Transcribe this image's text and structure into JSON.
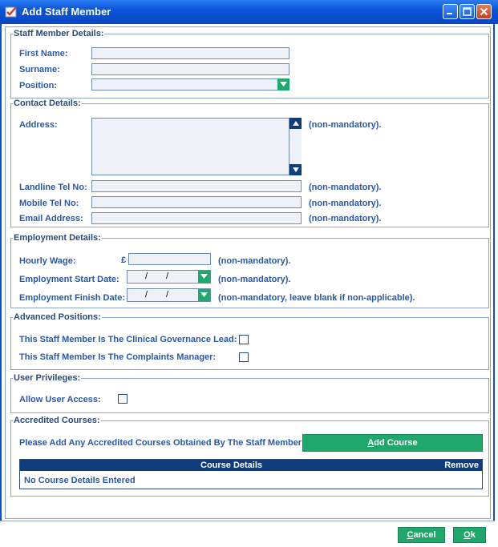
{
  "window": {
    "title": "Add Staff Member"
  },
  "staff_details": {
    "legend": "Staff Member Details:",
    "first_name_label": "First Name:",
    "first_name_value": "",
    "surname_label": "Surname:",
    "surname_value": "",
    "position_label": "Position:",
    "position_value": ""
  },
  "contact_details": {
    "legend": "Contact Details:",
    "address_label": "Address:",
    "address_note": "(non-mandatory).",
    "landline_label": "Landline Tel No:",
    "landline_note": "(non-mandatory).",
    "mobile_label": "Mobile Tel No:",
    "mobile_note": "(non-mandatory).",
    "email_label": "Email Address:",
    "email_note": "(non-mandatory)."
  },
  "employment": {
    "legend": "Employment Details:",
    "wage_label": "Hourly Wage:",
    "currency_symbol": "£",
    "wage_note": "(non-mandatory).",
    "start_label": "Employment Start Date:",
    "start_note": "(non-mandatory).",
    "finish_label": "Employment Finish Date:",
    "finish_note": "(non-mandatory, leave blank if non-applicable).",
    "date_separator": "/"
  },
  "advanced": {
    "legend": "Advanced Positions:",
    "clinical_label": "This Staff Member Is The Clinical Governance Lead:",
    "complaints_label": "This Staff Member Is The Complaints Manager:"
  },
  "privileges": {
    "legend": "User Privileges:",
    "allow_label": "Allow User Access:"
  },
  "courses": {
    "legend": "Accredited Courses:",
    "prompt": "Please Add Any Accredited Courses Obtained By The Staff Member:",
    "add_button_mnemonic": "A",
    "add_button_rest": "dd Course",
    "col_details": "Course Details",
    "col_remove": "Remove",
    "empty_text": "No Course Details Entered"
  },
  "footer": {
    "cancel_mnemonic": "C",
    "cancel_rest": "ancel",
    "ok_mnemonic": "O",
    "ok_rest": "k"
  },
  "colors": {
    "accent_green": "#20a86c",
    "label_blue": "#2a58a8",
    "title_blue": "#0a55d8"
  }
}
